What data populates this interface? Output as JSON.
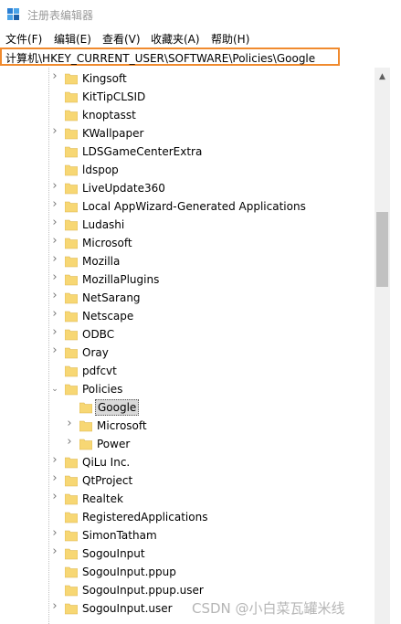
{
  "window": {
    "title": "注册表编辑器"
  },
  "menu": [
    {
      "label": "文件(F)"
    },
    {
      "label": "编辑(E)"
    },
    {
      "label": "查看(V)"
    },
    {
      "label": "收藏夹(A)"
    },
    {
      "label": "帮助(H)"
    }
  ],
  "address": {
    "value": "计算机\\HKEY_CURRENT_USER\\SOFTWARE\\Policies\\Google"
  },
  "tree": [
    {
      "label": "Kingsoft",
      "level": 1,
      "chevron": "right"
    },
    {
      "label": "KitTipCLSID",
      "level": 1,
      "chevron": "none"
    },
    {
      "label": "knoptasst",
      "level": 1,
      "chevron": "none"
    },
    {
      "label": "KWallpaper",
      "level": 1,
      "chevron": "right"
    },
    {
      "label": "LDSGameCenterExtra",
      "level": 1,
      "chevron": "none"
    },
    {
      "label": "ldspop",
      "level": 1,
      "chevron": "none"
    },
    {
      "label": "LiveUpdate360",
      "level": 1,
      "chevron": "right"
    },
    {
      "label": "Local AppWizard-Generated Applications",
      "level": 1,
      "chevron": "right"
    },
    {
      "label": "Ludashi",
      "level": 1,
      "chevron": "right"
    },
    {
      "label": "Microsoft",
      "level": 1,
      "chevron": "right"
    },
    {
      "label": "Mozilla",
      "level": 1,
      "chevron": "right"
    },
    {
      "label": "MozillaPlugins",
      "level": 1,
      "chevron": "right"
    },
    {
      "label": "NetSarang",
      "level": 1,
      "chevron": "right"
    },
    {
      "label": "Netscape",
      "level": 1,
      "chevron": "right"
    },
    {
      "label": "ODBC",
      "level": 1,
      "chevron": "right"
    },
    {
      "label": "Oray",
      "level": 1,
      "chevron": "right"
    },
    {
      "label": "pdfcvt",
      "level": 1,
      "chevron": "none"
    },
    {
      "label": "Policies",
      "level": 1,
      "chevron": "down"
    },
    {
      "label": "Google",
      "level": 2,
      "chevron": "none",
      "selected": true
    },
    {
      "label": "Microsoft",
      "level": 2,
      "chevron": "right"
    },
    {
      "label": "Power",
      "level": 2,
      "chevron": "right"
    },
    {
      "label": "QiLu Inc.",
      "level": 1,
      "chevron": "right"
    },
    {
      "label": "QtProject",
      "level": 1,
      "chevron": "right"
    },
    {
      "label": "Realtek",
      "level": 1,
      "chevron": "right"
    },
    {
      "label": "RegisteredApplications",
      "level": 1,
      "chevron": "none"
    },
    {
      "label": "SimonTatham",
      "level": 1,
      "chevron": "right"
    },
    {
      "label": "SogouInput",
      "level": 1,
      "chevron": "right"
    },
    {
      "label": "SogouInput.ppup",
      "level": 1,
      "chevron": "none"
    },
    {
      "label": "SogouInput.ppup.user",
      "level": 1,
      "chevron": "none"
    },
    {
      "label": "SogouInput.user",
      "level": 1,
      "chevron": "right"
    }
  ],
  "icons": {
    "folder": "folder-icon",
    "app": "regedit-icon",
    "expand": "chevron-right-icon",
    "collapse": "chevron-down-icon"
  },
  "colors": {
    "address_border": "#f08a2e",
    "folder": "#f7d774",
    "selection": "#d9d9d9"
  },
  "watermark": "CSDN @小白菜瓦罐米线"
}
